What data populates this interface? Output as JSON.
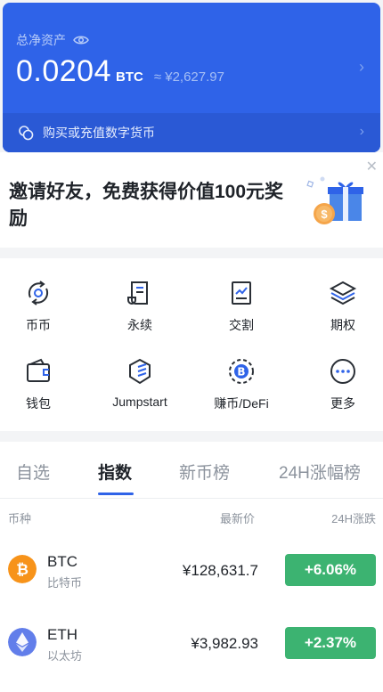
{
  "asset": {
    "label": "总净资产",
    "value": "0.0204",
    "unit": "BTC",
    "fiat": "≈ ¥2,627.97",
    "buy_text": "购买或充值数字货币"
  },
  "invite": {
    "text": "邀请好友，免费获得价值100元奖励"
  },
  "menu": {
    "items": [
      {
        "label": "币币",
        "icon": "coin-exchange-icon"
      },
      {
        "label": "永续",
        "icon": "document-icon"
      },
      {
        "label": "交割",
        "icon": "chart-document-icon"
      },
      {
        "label": "期权",
        "icon": "layers-icon"
      },
      {
        "label": "钱包",
        "icon": "wallet-icon"
      },
      {
        "label": "Jumpstart",
        "icon": "jumpstart-icon"
      },
      {
        "label": "赚币/DeFi",
        "icon": "bitcoin-circle-icon"
      },
      {
        "label": "更多",
        "icon": "more-icon"
      }
    ]
  },
  "market": {
    "tabs": [
      "自选",
      "指数",
      "新币榜",
      "24H涨幅榜"
    ],
    "active_tab": "指数",
    "headers": {
      "coin": "币种",
      "price": "最新价",
      "change": "24H涨跌"
    },
    "rows": [
      {
        "symbol": "BTC",
        "name": "比特币",
        "price": "¥128,631.7",
        "change": "+6.06%",
        "color": "#f7931a"
      },
      {
        "symbol": "ETH",
        "name": "以太坊",
        "price": "¥3,982.93",
        "change": "+2.37%",
        "color": "#627eea"
      }
    ]
  },
  "colors": {
    "accent": "#2f63e8",
    "up": "#3cb371"
  }
}
